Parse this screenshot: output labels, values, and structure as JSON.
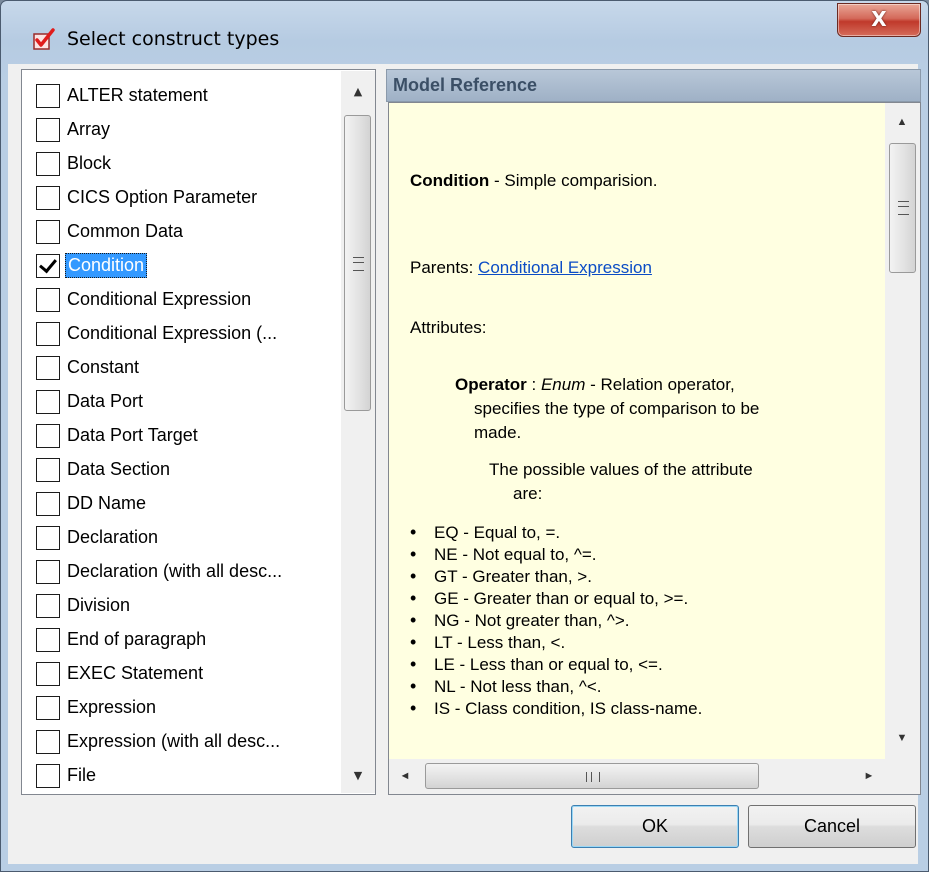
{
  "window": {
    "title": "Select construct types",
    "close_glyph": "X"
  },
  "list": {
    "items": [
      {
        "label": "ALTER statement",
        "checked": false
      },
      {
        "label": "Array",
        "checked": false
      },
      {
        "label": "Block",
        "checked": false
      },
      {
        "label": "CICS Option Parameter",
        "checked": false
      },
      {
        "label": "Common Data",
        "checked": false
      },
      {
        "label": "Condition",
        "checked": true,
        "selected": true
      },
      {
        "label": "Conditional Expression",
        "checked": false
      },
      {
        "label": "Conditional Expression (...",
        "checked": false
      },
      {
        "label": "Constant",
        "checked": false
      },
      {
        "label": "Data Port",
        "checked": false
      },
      {
        "label": "Data Port Target",
        "checked": false
      },
      {
        "label": "Data Section",
        "checked": false
      },
      {
        "label": "DD Name",
        "checked": false
      },
      {
        "label": "Declaration",
        "checked": false
      },
      {
        "label": "Declaration (with all desc...",
        "checked": false
      },
      {
        "label": "Division",
        "checked": false
      },
      {
        "label": "End of paragraph",
        "checked": false
      },
      {
        "label": "EXEC Statement",
        "checked": false
      },
      {
        "label": "Expression",
        "checked": false
      },
      {
        "label": "Expression (with all desc...",
        "checked": false
      },
      {
        "label": "File",
        "checked": false
      }
    ]
  },
  "reference": {
    "header": "Model Reference",
    "construct_name": "Condition",
    "construct_desc": " - Simple comparision.",
    "parents_label": "Parents: ",
    "parents_link": "Conditional Expression",
    "attributes_label": "Attributes:",
    "attr_name": "Operator",
    "attr_sep": " : ",
    "attr_type": "Enum",
    "attr_desc_1": " - Relation operator,",
    "attr_desc_2": "specifies the type of comparison to be",
    "attr_desc_3": "made.",
    "values_1": "The possible values of the attribute",
    "values_2": "are:",
    "values": [
      "EQ - Equal to, =.",
      "NE - Not equal to, ^=.",
      "GT - Greater than, >.",
      "GE - Greater than or equal to, >=.",
      "NG - Not greater than, ^>.",
      "LT - Less than, <.",
      "LE - Less than or equal to, <=.",
      "NL - Not less than, ^<.",
      "IS - Class condition, IS class-name."
    ]
  },
  "scroll": {
    "up": "▲",
    "down": "▼",
    "left": "◄",
    "right": "►"
  },
  "buttons": {
    "ok": "OK",
    "cancel": "Cancel"
  },
  "colors": {
    "selection": "#3399ff",
    "info_background": "#ffffe1",
    "link": "#0b4cc5"
  }
}
